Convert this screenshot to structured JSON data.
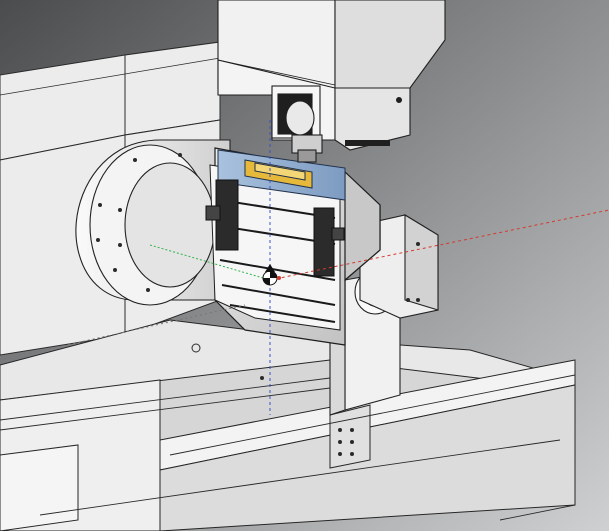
{
  "viewport": {
    "background_top": "#4d4f51",
    "background_bottom": "#c9cacb"
  },
  "colors": {
    "housing": "#f2f2f2",
    "housing_shade": "#cfcfcf",
    "edge": "#2a2a2a",
    "table_dark": "#2e2e2e",
    "workpiece": "#9fb9d6",
    "workpiece_highlight": "#e6b93b",
    "axis_x": "#d43a2f",
    "axis_y": "#2fb34a",
    "axis_z": "#3f51c9"
  },
  "icons": {
    "origin_marker": "triad-origin-icon"
  }
}
